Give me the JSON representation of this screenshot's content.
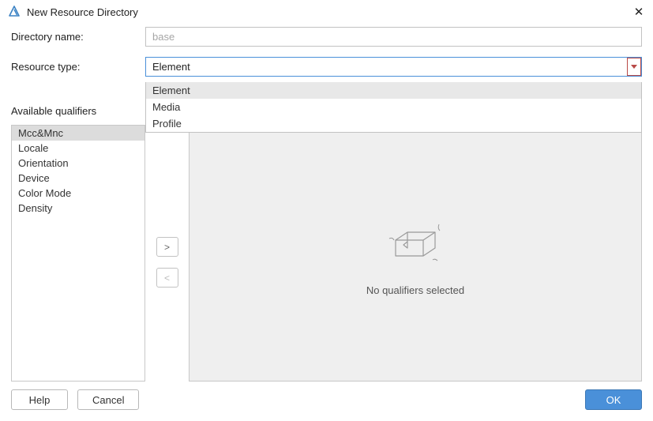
{
  "title": "New Resource Directory",
  "labels": {
    "directory_name": "Directory name:",
    "resource_type": "Resource type:",
    "available_qualifiers": "Available qualifiers"
  },
  "directory_name": {
    "placeholder": "base",
    "value": ""
  },
  "resource_type": {
    "selected": "Element",
    "options": [
      "Element",
      "Media",
      "Profile"
    ]
  },
  "qualifiers": [
    "Mcc&Mnc",
    "Locale",
    "Orientation",
    "Device",
    "Color Mode",
    "Density"
  ],
  "qualifier_selected_index": 0,
  "transfer": {
    "add": ">",
    "remove": "<"
  },
  "empty_state": "No qualifiers selected",
  "buttons": {
    "help": "Help",
    "cancel": "Cancel",
    "ok": "OK"
  },
  "colors": {
    "primary": "#4a90d9",
    "border": "#c2c2c2",
    "combo_accent": "#b94a48"
  }
}
